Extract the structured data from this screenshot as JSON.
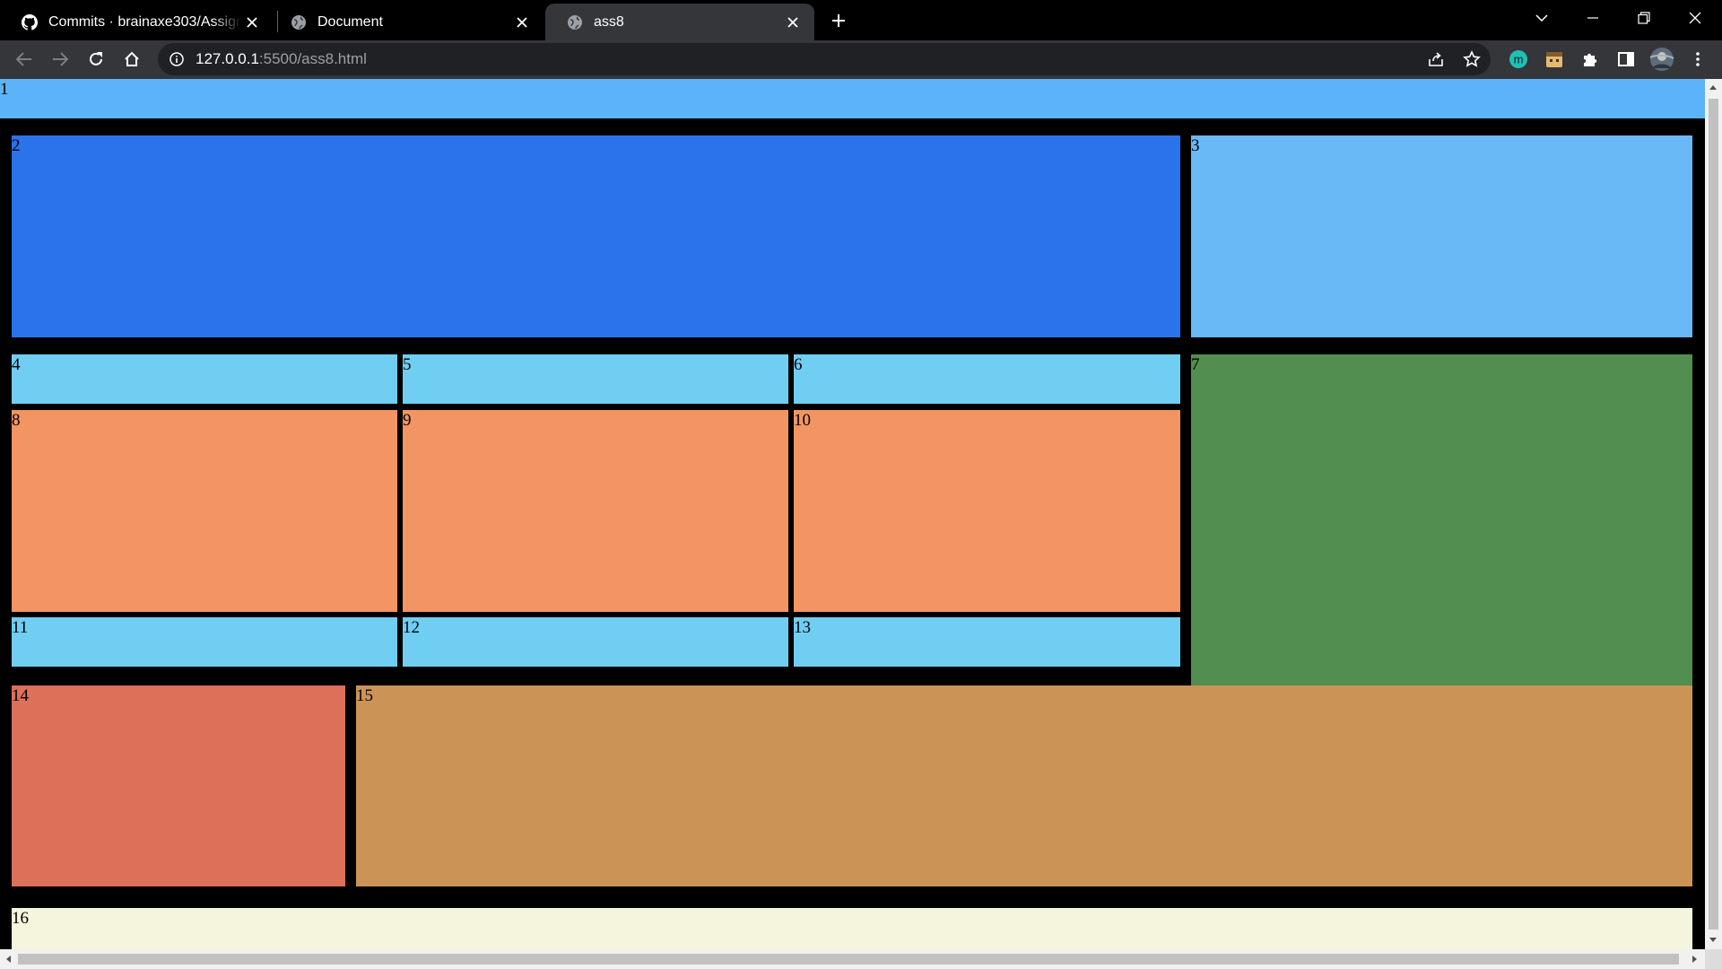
{
  "tabs": [
    {
      "title": "Commits · brainaxe303/Assignme",
      "icon": "github-icon",
      "active": false
    },
    {
      "title": "Document",
      "icon": "globe-icon",
      "active": false
    },
    {
      "title": "ass8",
      "icon": "globe-icon",
      "active": true
    }
  ],
  "address_bar": {
    "host": "127.0.0.1",
    "path": ":5500/ass8.html"
  },
  "extensions": [
    {
      "name": "m-extension-icon",
      "label": "m"
    },
    {
      "name": "face-extension-icon"
    },
    {
      "name": "puzzle-extensions-icon"
    },
    {
      "name": "side-panel-icon"
    },
    {
      "name": "profile-avatar"
    }
  ],
  "colors": {
    "blue_light": "#5cb3f8",
    "blue_dark": "#2a73ea",
    "sky": "#6ab9f7",
    "cyan": "#70cef3",
    "orange": "#f29562",
    "green": "#528e4f",
    "red": "#dd7058",
    "tan": "#cc9357",
    "cream": "#f5f5de"
  },
  "page": {
    "cells": [
      {
        "label": "1"
      },
      {
        "label": "2"
      },
      {
        "label": "3"
      },
      {
        "label": "4"
      },
      {
        "label": "5"
      },
      {
        "label": "6"
      },
      {
        "label": "7"
      },
      {
        "label": "8"
      },
      {
        "label": "9"
      },
      {
        "label": "10"
      },
      {
        "label": "11"
      },
      {
        "label": "12"
      },
      {
        "label": "13"
      },
      {
        "label": "14"
      },
      {
        "label": "15"
      },
      {
        "label": "16"
      }
    ]
  }
}
